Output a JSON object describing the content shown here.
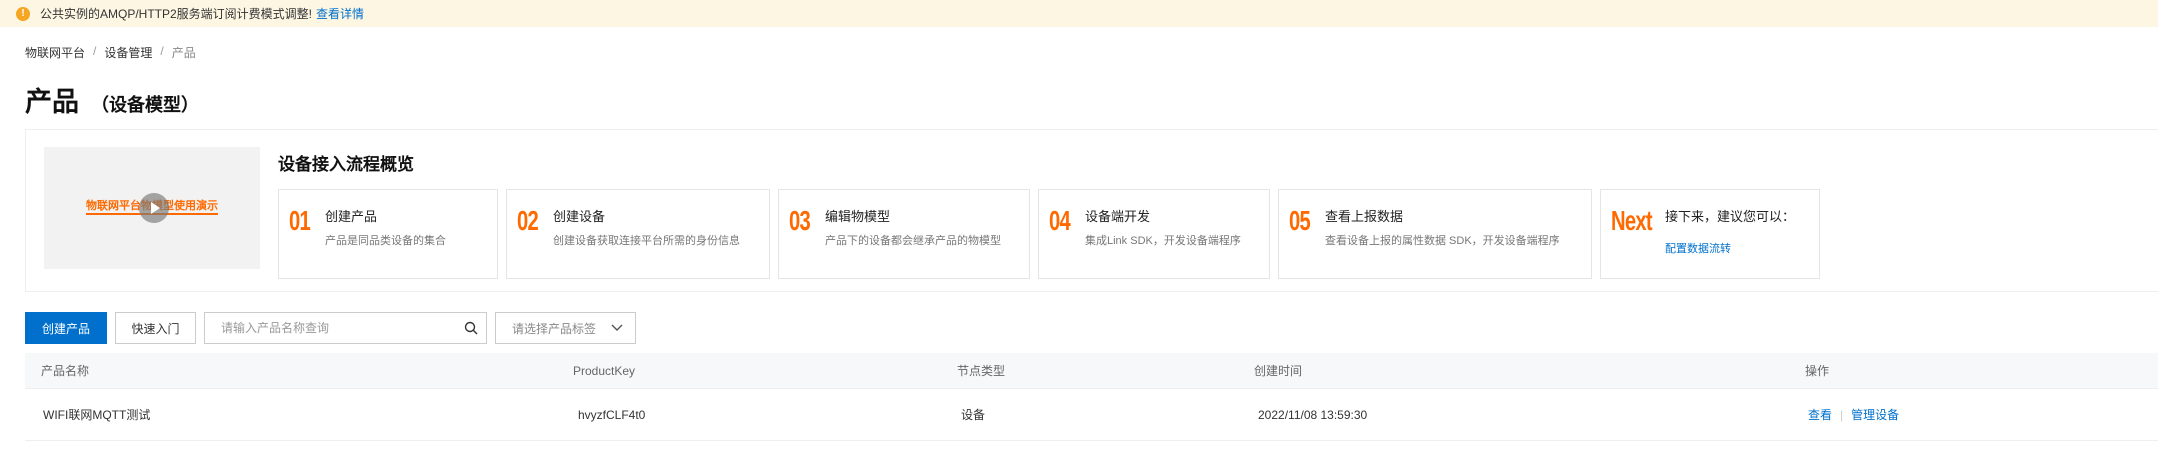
{
  "notice": {
    "text": "公共实例的AMQP/HTTP2服务端订阅计费模式调整!",
    "link": "查看详情",
    "icon": "warning-icon"
  },
  "breadcrumb": [
    "物联网平台",
    "设备管理",
    "产品"
  ],
  "page": {
    "title": "产品",
    "subtitle": "（设备模型）"
  },
  "flow": {
    "video_title": "物联网平台物模型使用演示",
    "title": "设备接入流程概览",
    "steps": [
      {
        "num": "01",
        "title": "创建产品",
        "desc": "产品是同品类设备的集合"
      },
      {
        "num": "02",
        "title": "创建设备",
        "desc": "创建设备获取连接平台所需的身份信息"
      },
      {
        "num": "03",
        "title": "编辑物模型",
        "desc": "产品下的设备都会继承产品的物模型"
      },
      {
        "num": "04",
        "title": "设备端开发",
        "desc": "集成Link SDK，开发设备端程序"
      },
      {
        "num": "05",
        "title": "查看上报数据",
        "desc": "查看设备上报的属性数据 SDK，开发设备端程序"
      },
      {
        "num": "Next",
        "title": "接下来，建议您可以：",
        "link": "配置数据流转"
      }
    ]
  },
  "toolbar": {
    "create_label": "创建产品",
    "quickstart_label": "快速入门",
    "search_placeholder": "请输入产品名称查询",
    "tag_select": "请选择产品标签"
  },
  "table": {
    "headers": [
      "产品名称",
      "ProductKey",
      "节点类型",
      "创建时间",
      "操作"
    ],
    "rows": [
      {
        "name": "WIFI联网MQTT测试",
        "key": "hvyzfCLF4t0",
        "node_type": "设备",
        "created": "2022/11/08 13:59:30",
        "op_view": "查看",
        "op_manage": "管理设备"
      }
    ]
  },
  "colors": {
    "accent": "#0070cc",
    "orange": "#ff6a00",
    "notice_bg": "#fdf6e3"
  }
}
